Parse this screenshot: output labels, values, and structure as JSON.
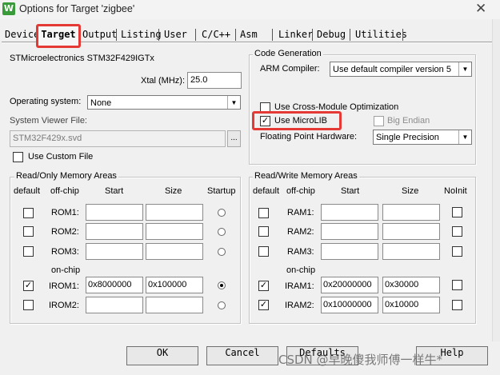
{
  "window": {
    "title": "Options for Target 'zigbee'",
    "app_icon": "keil-uvision-icon",
    "app_icon_glyph": "W",
    "close_glyph": "✕"
  },
  "tabs": [
    "Device",
    "Target",
    "Output",
    "Listing",
    "User",
    "C/C++",
    "Asm",
    "Linker",
    "Debug",
    "Utilities"
  ],
  "active_tab": "Target",
  "target": {
    "device_name": "STMicroelectronics STM32F429IGTx",
    "xtal_label": "Xtal (MHz):",
    "xtal_value": "25.0",
    "os_label": "Operating system:",
    "os_value": "None",
    "svd_label": "System Viewer File:",
    "svd_value": "STM32F429x.svd",
    "svd_browse": "...",
    "custom_file_label": "Use Custom File",
    "custom_file_checked": false
  },
  "code_generation": {
    "group_title": "Code Generation",
    "arm_compiler_label": "ARM Compiler:",
    "arm_compiler_value": "Use default compiler version 5",
    "cross_module_label": "Use Cross-Module Optimization",
    "cross_module_checked": false,
    "microlib_label": "Use MicroLIB",
    "microlib_checked": true,
    "big_endian_label": "Big Endian",
    "big_endian_checked": false,
    "fp_hardware_label": "Floating Point Hardware:",
    "fp_hardware_value": "Single Precision"
  },
  "ro_memory": {
    "group_title": "Read/Only Memory Areas",
    "headers": {
      "default": "default",
      "offchip": "off-chip",
      "start": "Start",
      "size": "Size",
      "startup": "Startup"
    },
    "onchip_label": "on-chip",
    "rows": [
      {
        "name": "ROM1:",
        "default": false,
        "start": "",
        "size": "",
        "startup": false
      },
      {
        "name": "ROM2:",
        "default": false,
        "start": "",
        "size": "",
        "startup": false
      },
      {
        "name": "ROM3:",
        "default": false,
        "start": "",
        "size": "",
        "startup": false
      },
      {
        "name": "IROM1:",
        "default": true,
        "start": "0x8000000",
        "size": "0x100000",
        "startup": true
      },
      {
        "name": "IROM2:",
        "default": false,
        "start": "",
        "size": "",
        "startup": false
      }
    ]
  },
  "rw_memory": {
    "group_title": "Read/Write Memory Areas",
    "headers": {
      "default": "default",
      "offchip": "off-chip",
      "start": "Start",
      "size": "Size",
      "noinit": "NoInit"
    },
    "onchip_label": "on-chip",
    "rows": [
      {
        "name": "RAM1:",
        "default": false,
        "start": "",
        "size": "",
        "noinit": false
      },
      {
        "name": "RAM2:",
        "default": false,
        "start": "",
        "size": "",
        "noinit": false
      },
      {
        "name": "RAM3:",
        "default": false,
        "start": "",
        "size": "",
        "noinit": false
      },
      {
        "name": "IRAM1:",
        "default": true,
        "start": "0x20000000",
        "size": "0x30000",
        "noinit": false
      },
      {
        "name": "IRAM2:",
        "default": true,
        "start": "0x10000000",
        "size": "0x10000",
        "noinit": false
      }
    ]
  },
  "buttons": {
    "ok": "OK",
    "cancel": "Cancel",
    "defaults": "Defaults",
    "help": "Help"
  },
  "watermark": "CSDN @早晚傻我师傅一样牛*",
  "highlight_color": "#e53935"
}
